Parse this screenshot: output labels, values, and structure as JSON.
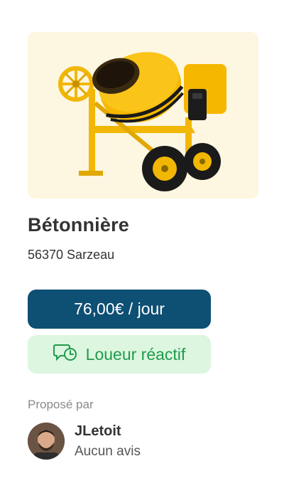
{
  "listing": {
    "image_subject": "concrete-mixer",
    "title": "Bétonnière",
    "location": "56370 Sarzeau",
    "price_label": "76,00€ / jour",
    "badge_label": "Loueur réactif"
  },
  "owner": {
    "section_label": "Proposé par",
    "name": "JLetoit",
    "reviews": "Aucun avis"
  },
  "colors": {
    "price_bg": "#0e4f74",
    "badge_bg": "#ddf6df",
    "badge_text": "#1f9b4b",
    "image_bg": "#fdf6e0"
  },
  "icons": {
    "badge_icon": "chat-clock-icon"
  }
}
